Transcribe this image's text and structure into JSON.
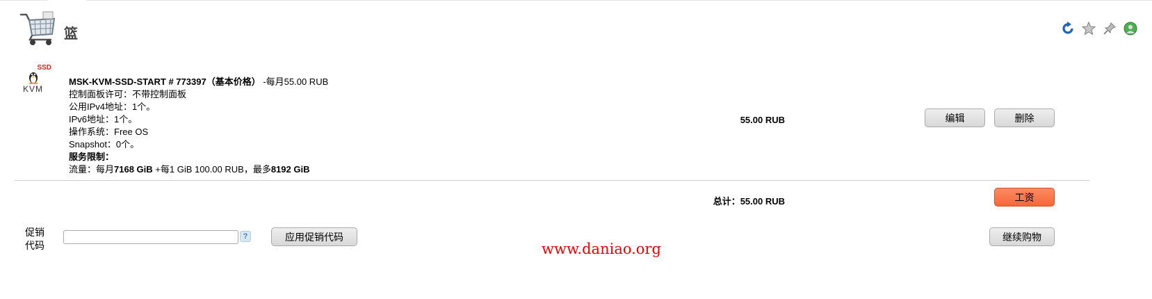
{
  "header": {
    "title": "篮"
  },
  "product": {
    "logo_ssd": "SSD",
    "logo_kvm": "KVM",
    "name": "MSK-KVM-SSD-START # 773397（基本价格）",
    "billing": "-每月55.00 RUB",
    "lines": [
      "控制面板许可：不带控制面板",
      "公用IPv4地址：1个。",
      "IPv6地址：1个。",
      "操作系统：Free OS",
      "Snapshot：0个。"
    ],
    "limits_title": "服务限制：",
    "traffic": {
      "prefix": "流量：每月",
      "amount": "7168 GiB",
      "middle": " +每1 GiB 100.00 RUB，最多",
      "max": "8192 GiB"
    },
    "price": "55.00 RUB",
    "edit_label": "编辑",
    "delete_label": "删除"
  },
  "summary": {
    "total": "总计：55.00 RUB",
    "pay_label": "工资"
  },
  "promo": {
    "label_line1": "促销",
    "label_line2": "代码",
    "value": "",
    "help": "?",
    "apply_label": "应用促销代码",
    "continue_label": "继续购物"
  },
  "watermark": "www.daniao.org",
  "colors": {
    "pay_button": "#fb7b50",
    "watermark": "#e00000"
  }
}
